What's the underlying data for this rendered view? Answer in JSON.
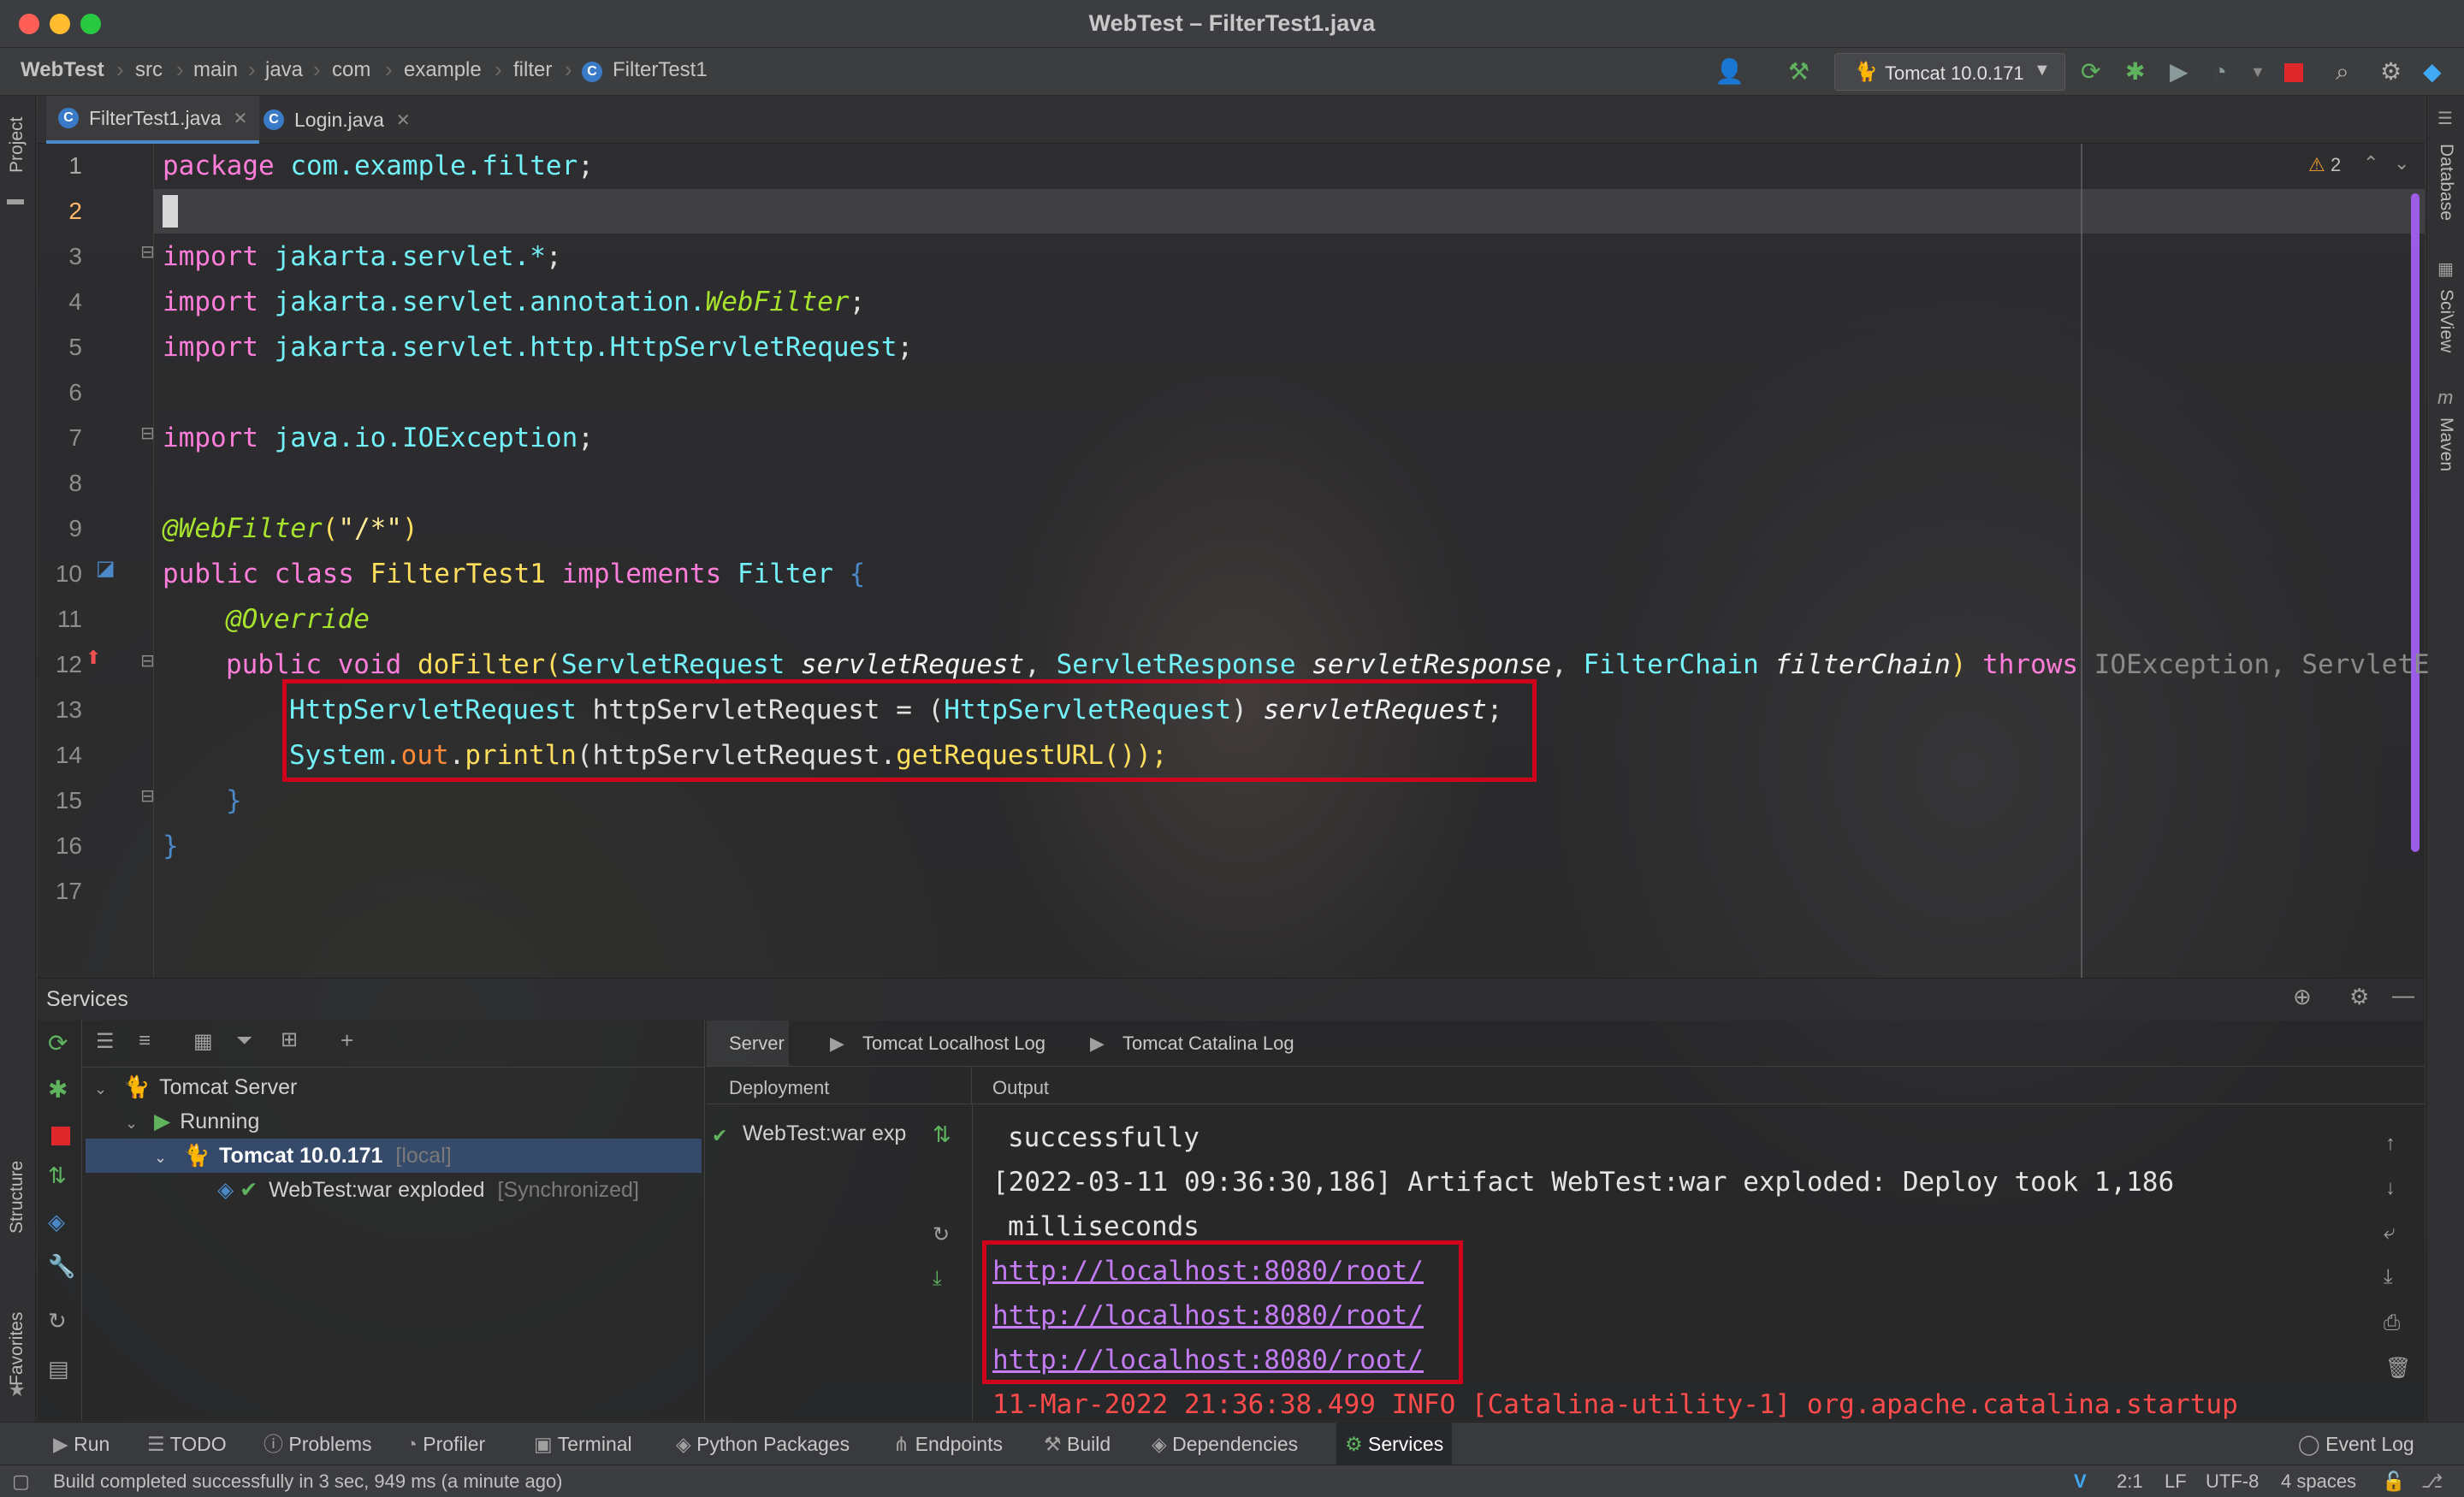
{
  "window": {
    "title": "WebTest – FilterTest1.java"
  },
  "navbar": {
    "breadcrumbs": [
      "WebTest",
      "src",
      "main",
      "java",
      "com",
      "example",
      "filter",
      "FilterTest1"
    ],
    "run_config": "Tomcat 10.0.171"
  },
  "editor_tabs": [
    {
      "label": "FilterTest1.java",
      "active": true
    },
    {
      "label": "Login.java",
      "active": false
    }
  ],
  "side_panels": {
    "left": [
      "Project",
      "Structure",
      "Favorites"
    ],
    "right": [
      "Database",
      "SciView",
      "Maven"
    ]
  },
  "editor": {
    "warnings": "2",
    "line_numbers": [
      "1",
      "2",
      "3",
      "4",
      "5",
      "6",
      "7",
      "8",
      "9",
      "10",
      "11",
      "12",
      "13",
      "14",
      "15",
      "16",
      "17"
    ],
    "lines": {
      "l1": [
        "package",
        " com.example.filter",
        ";"
      ],
      "l3": [
        "import",
        " jakarta.servlet.*",
        ";"
      ],
      "l4": [
        "import",
        " jakarta.servlet.annotation.",
        "WebFilter",
        ";"
      ],
      "l5": [
        "import",
        " jakarta.servlet.http.HttpServletRequest",
        ";"
      ],
      "l7": [
        "import",
        " java.io.IOException",
        ";"
      ],
      "l9": [
        "@WebFilter",
        "(",
        "\"/*\"",
        ")"
      ],
      "l10": [
        "public class",
        " FilterTest1 ",
        "implements",
        " Filter ",
        "{"
      ],
      "l11": [
        "@Override"
      ],
      "l12": [
        "public void",
        " doFilter",
        "(",
        "ServletRequest",
        " servletRequest",
        ", ",
        "ServletResponse",
        " servletResponse",
        ", ",
        "FilterChain",
        " filterChain",
        ") ",
        "throws",
        " IOException, ServletE"
      ],
      "l13": [
        "HttpServletRequest",
        " httpServletRequest = (",
        "HttpServletRequest",
        ") ",
        "servletRequest",
        ";"
      ],
      "l14": [
        "System.",
        "out",
        ".",
        "println",
        "(httpServletRequest.",
        "getRequestURL",
        "());"
      ],
      "l15": [
        "}"
      ],
      "l16": [
        "}"
      ]
    }
  },
  "services": {
    "title": "Services",
    "tree": {
      "server": "Tomcat Server",
      "running": "Running",
      "instance": "Tomcat 10.0.171",
      "instance_tag": "[local]",
      "artifact": "WebTest:war exploded",
      "artifact_tag": "[Synchronized]"
    },
    "output_tabs": [
      "Server",
      "Tomcat Localhost Log",
      "Tomcat Catalina Log"
    ],
    "deployment_header": "Deployment",
    "output_header": "Output",
    "deployment_item": "WebTest:war exp",
    "output_lines": [
      "successfully",
      "[2022-03-11 09:36:30,186] Artifact WebTest:war exploded: Deploy took 1,186",
      "milliseconds",
      "http://localhost:8080/root/",
      "http://localhost:8080/root/",
      "http://localhost:8080/root/",
      "11-Mar-2022 21:36:38.499 INFO [Catalina-utility-1] org.apache.catalina.startup"
    ]
  },
  "tool_windows": [
    "Run",
    "TODO",
    "Problems",
    "Profiler",
    "Terminal",
    "Python Packages",
    "Endpoints",
    "Build",
    "Dependencies",
    "Services"
  ],
  "active_tool_window": "Services",
  "event_log": "Event Log",
  "status": {
    "message": "Build completed successfully in 3 sec, 949 ms (a minute ago)",
    "position": "2:1",
    "line_sep": "LF",
    "encoding": "UTF-8",
    "indent": "4 spaces"
  },
  "colors": {
    "highlight_box": "#d0021b",
    "link": "#c47cf5",
    "accent": "#4a88c7"
  }
}
